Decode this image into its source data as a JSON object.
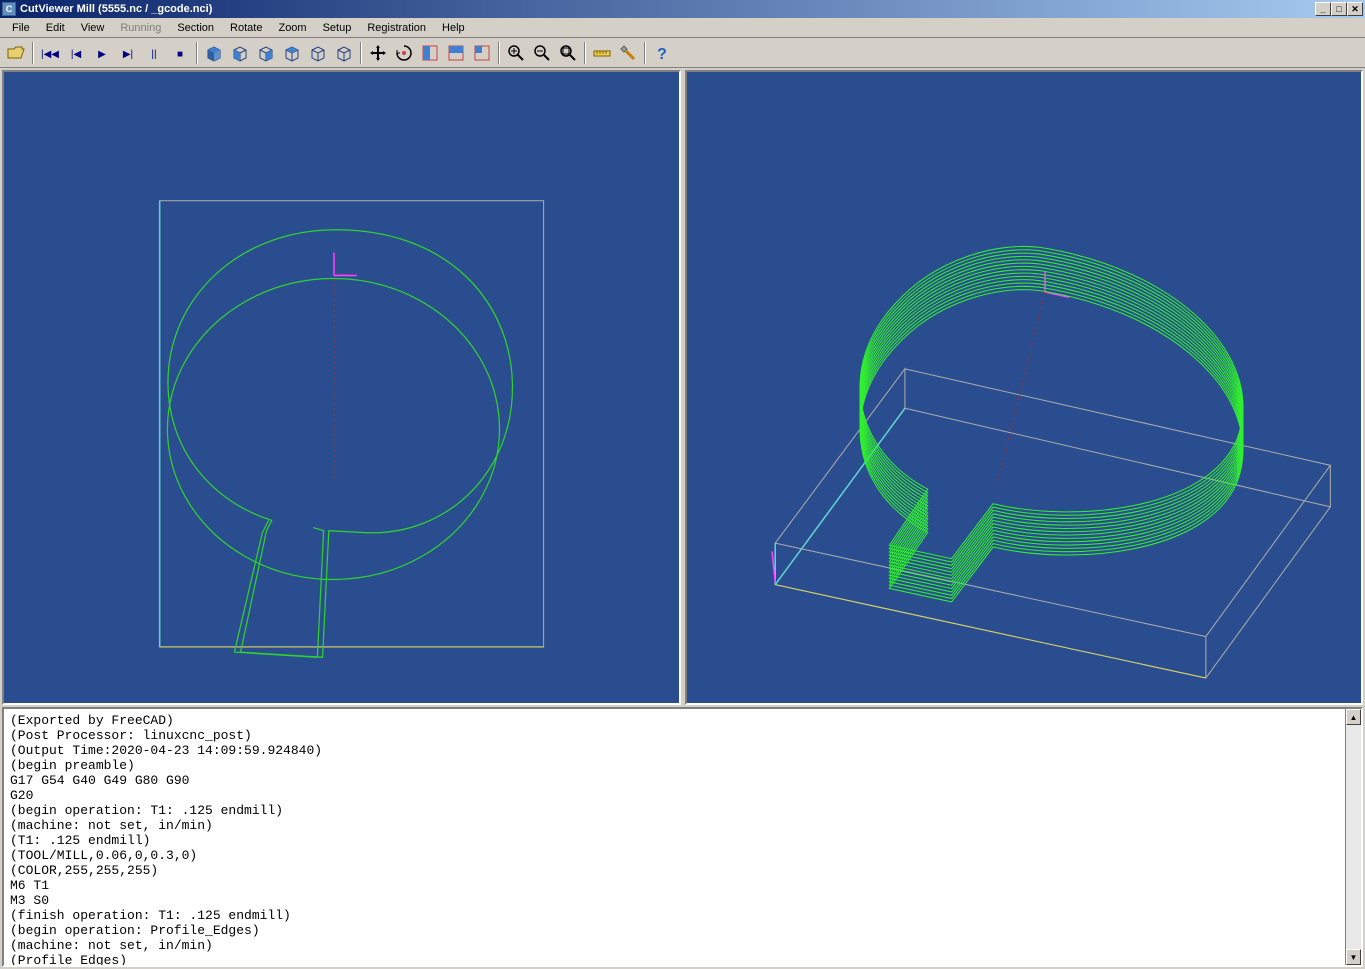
{
  "title": "CutViewer Mill (5555.nc / _gcode.nci)",
  "window_buttons": {
    "min": "_",
    "max": "□",
    "close": "✕"
  },
  "menus": [
    "File",
    "Edit",
    "View",
    "Running",
    "Section",
    "Rotate",
    "Zoom",
    "Setup",
    "Registration",
    "Help"
  ],
  "menu_disabled_index": 3,
  "toolbar": [
    {
      "name": "open-icon",
      "type": "open"
    },
    {
      "sep": true
    },
    {
      "name": "rewind-icon",
      "type": "nav",
      "glyph": "|◀◀"
    },
    {
      "name": "step-back-icon",
      "type": "nav",
      "glyph": "|◀"
    },
    {
      "name": "play-icon",
      "type": "nav",
      "glyph": "▶"
    },
    {
      "name": "step-fwd-icon",
      "type": "nav",
      "glyph": "▶|"
    },
    {
      "name": "pause-icon",
      "type": "nav",
      "glyph": "||"
    },
    {
      "name": "stop-icon",
      "type": "nav",
      "glyph": "■"
    },
    {
      "sep": true
    },
    {
      "name": "view-solid-icon",
      "type": "cube",
      "shade": "full"
    },
    {
      "name": "view-front-icon",
      "type": "cube",
      "shade": "left"
    },
    {
      "name": "view-side-icon",
      "type": "cube",
      "shade": "right"
    },
    {
      "name": "view-top-icon",
      "type": "cube",
      "shade": "top"
    },
    {
      "name": "view-iso-icon",
      "type": "cube",
      "shade": "wire"
    },
    {
      "name": "view-wire-icon",
      "type": "cube",
      "shade": "wireonly"
    },
    {
      "sep": true
    },
    {
      "name": "pan-icon",
      "type": "pan"
    },
    {
      "name": "rotate-icon",
      "type": "rotate"
    },
    {
      "name": "section-x-icon",
      "type": "section",
      "axis": "x"
    },
    {
      "name": "section-y-icon",
      "type": "section",
      "axis": "y"
    },
    {
      "name": "section-xy-icon",
      "type": "section",
      "axis": "xy"
    },
    {
      "sep": true
    },
    {
      "name": "zoom-in-icon",
      "type": "zoom",
      "mode": "in"
    },
    {
      "name": "zoom-out-icon",
      "type": "zoom",
      "mode": "out"
    },
    {
      "name": "zoom-fit-icon",
      "type": "zoom",
      "mode": "fit"
    },
    {
      "sep": true
    },
    {
      "name": "measure-icon",
      "type": "measure"
    },
    {
      "name": "tools-icon",
      "type": "tools"
    },
    {
      "sep": true
    },
    {
      "name": "help-icon",
      "type": "help"
    }
  ],
  "gcode_lines": [
    "(Exported by FreeCAD)",
    "(Post Processor: linuxcnc_post)",
    "(Output Time:2020-04-23 14:09:59.924840)",
    "(begin preamble)",
    "G17 G54 G40 G49 G80 G90",
    "G20",
    "(begin operation: T1: .125 endmill)",
    "(machine: not set, in/min)",
    "(T1: .125 endmill)",
    "(TOOL/MILL,0.06,0,0.3,0)",
    "(COLOR,255,255,255)",
    "M6 T1",
    "M3 S0",
    "(finish operation: T1: .125 endmill)",
    "(begin operation: Profile_Edges)",
    "(machine: not set, in/min)",
    "(Profile_Edges)"
  ]
}
